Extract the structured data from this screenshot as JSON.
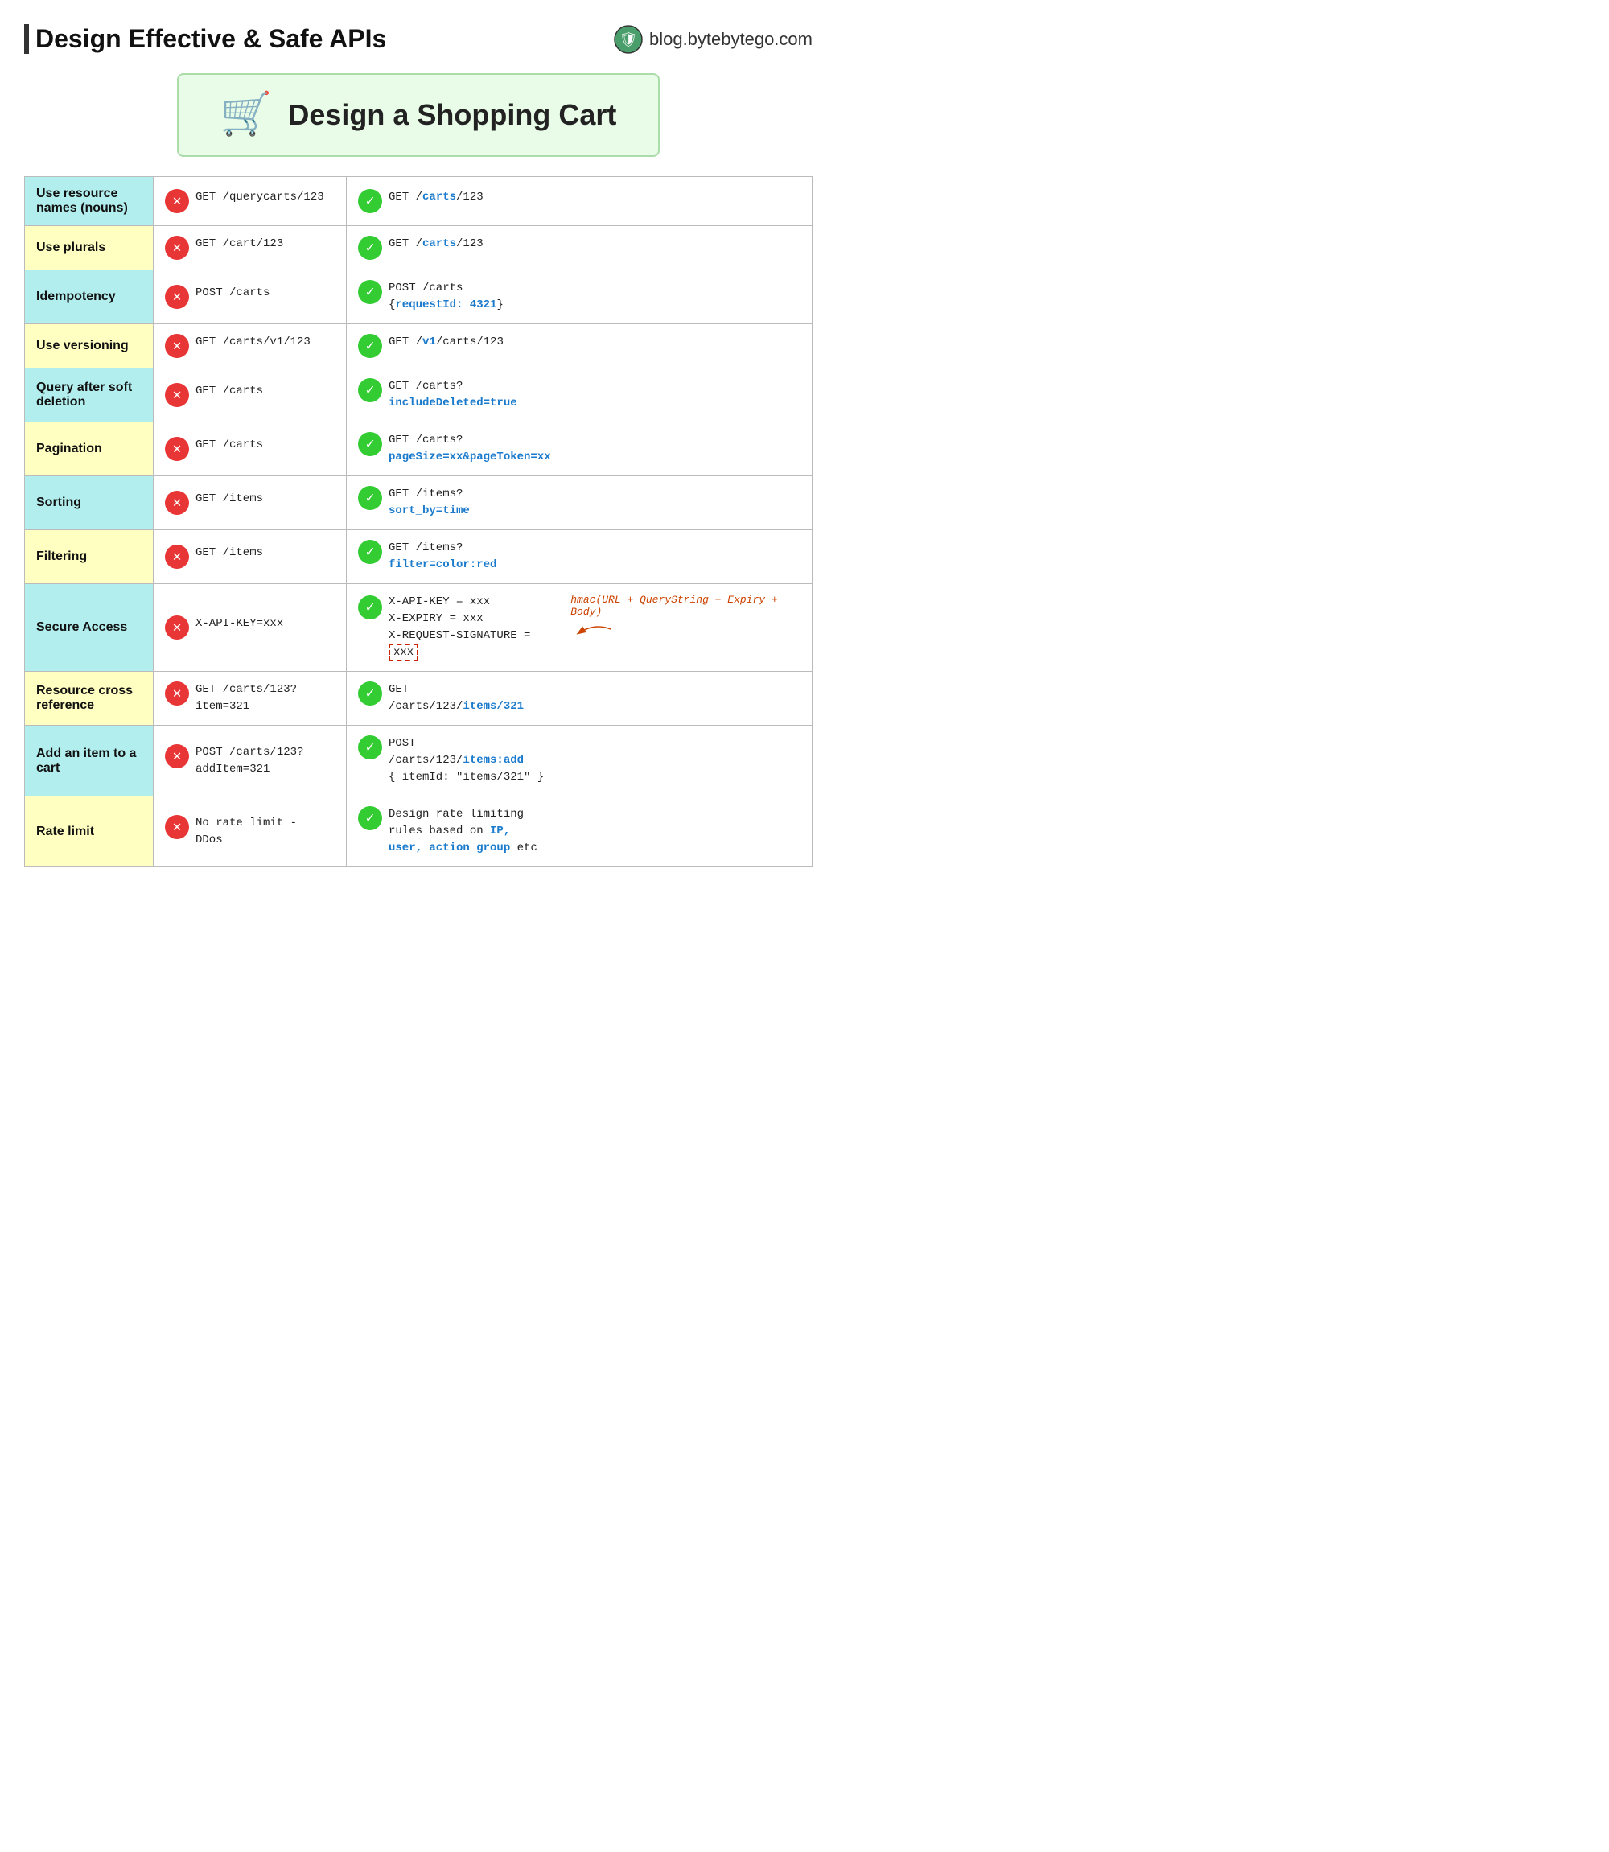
{
  "header": {
    "title": "Design Effective & Safe APIs",
    "brand_text": "blog.bytebytego.com"
  },
  "hero": {
    "title": "Design a Shopping Cart",
    "cart_emoji": "🛒"
  },
  "rows": [
    {
      "label": "Use resource names (nouns)",
      "color": "cyan",
      "bad": "GET /querycarts/123",
      "good_plain": "GET /",
      "good_highlight": "carts",
      "good_suffix": "/123"
    },
    {
      "label": "Use plurals",
      "color": "yellow",
      "bad": "GET /cart/123",
      "good_plain": "GET /",
      "good_highlight": "carts",
      "good_suffix": "/123"
    },
    {
      "label": "Idempotency",
      "color": "cyan",
      "bad": "POST /carts",
      "good_line1": "POST /carts",
      "good_line2": "{requestId: 4321}"
    },
    {
      "label": "Use versioning",
      "color": "yellow",
      "bad": "GET /carts/v1/123",
      "good_prefix": "GET /",
      "good_highlight": "v1",
      "good_suffix": "/carts/123"
    },
    {
      "label": "Query after soft deletion",
      "color": "cyan",
      "bad": "GET /carts",
      "good_line1": "GET /carts?",
      "good_line2_blue": "includeDeleted=true"
    },
    {
      "label": "Pagination",
      "color": "yellow",
      "bad": "GET /carts",
      "good_line1": "GET /carts?",
      "good_line2_blue": "pageSize=xx&pageToken=xx"
    },
    {
      "label": "Sorting",
      "color": "cyan",
      "bad": "GET /items",
      "good_line1": "GET /items?",
      "good_line2_blue": "sort_by=time"
    },
    {
      "label": "Filtering",
      "color": "yellow",
      "bad": "GET /items",
      "good_line1": "GET /items?",
      "good_line2_blue": "filter=color:red"
    },
    {
      "label": "Secure Access",
      "color": "cyan",
      "bad": "X-API-KEY=xxx",
      "good_lines": [
        "X-API-KEY = xxx",
        "X-EXPIRY = xxx",
        "X-REQUEST-SIGNATURE = "
      ],
      "good_dotted": "xxx",
      "annotation": "hmac(URL + QueryString + Expiry + Body)"
    },
    {
      "label": "Resource cross reference",
      "color": "yellow",
      "bad_line1": "GET /carts/123?",
      "bad_line2": "item=321",
      "good_line1": "GET",
      "good_line2_prefix": "/carts/123/",
      "good_line2_blue": "items/321"
    },
    {
      "label": "Add an item to a cart",
      "color": "cyan",
      "bad_line1": "POST /carts/123?",
      "bad_line2": "addItem=321",
      "good_line1": "POST",
      "good_line2_prefix": "/carts/123/",
      "good_line2_blue": "items:add",
      "good_line3": "{ itemId: \"items/321\" }"
    },
    {
      "label": "Rate limit",
      "color": "yellow",
      "bad_line1": "No rate limit -",
      "bad_line2": "DDos",
      "good_line1": "Design rate limiting",
      "good_line2": "rules based on ",
      "good_blue1": "IP,",
      "good_line3": "user, action group",
      "good_line3_suffix": " etc"
    }
  ]
}
